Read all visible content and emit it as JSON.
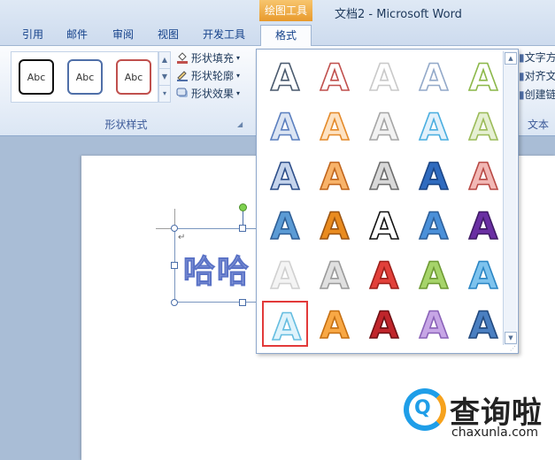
{
  "window": {
    "context_tab": "绘图工具",
    "doc_title": "文档2  -  Microsoft Word"
  },
  "tabs": [
    {
      "label": "引用"
    },
    {
      "label": "邮件"
    },
    {
      "label": "审阅"
    },
    {
      "label": "视图"
    },
    {
      "label": "开发工具"
    },
    {
      "label": "格式",
      "active": true
    }
  ],
  "ribbon": {
    "shape_styles": {
      "thumbs": [
        {
          "label": "Abc",
          "border_color": "#111111"
        },
        {
          "label": "Abc",
          "border_color": "#4f6fa8"
        },
        {
          "label": "Abc",
          "border_color": "#c0504d"
        }
      ],
      "commands": [
        {
          "label": "形状填充",
          "icon": "paint-bucket-icon"
        },
        {
          "label": "形状轮廓",
          "icon": "pencil-outline-icon"
        },
        {
          "label": "形状效果",
          "icon": "shape-effects-icon"
        }
      ],
      "group_label": "形状样式"
    },
    "text_group": {
      "commands": [
        {
          "label": "文字方向"
        },
        {
          "label": "对齐文本"
        },
        {
          "label": "创建链接"
        }
      ],
      "group_label": "文本"
    }
  },
  "document": {
    "wordart_text": "哈哈",
    "paragraph_mark": "↵"
  },
  "wordart_gallery": {
    "glyph": "A",
    "rows": [
      [
        {
          "fill": "#ffffff",
          "stroke": "#4a5a6e"
        },
        {
          "fill": "#ffffff",
          "stroke": "#c0504d"
        },
        {
          "fill": "#ffffff",
          "stroke": "#c9c9c9"
        },
        {
          "fill": "#ffffff",
          "stroke": "#93a9c9"
        },
        {
          "fill": "#ffffff",
          "stroke": "#8cb84a"
        }
      ],
      [
        {
          "fill": "#dce5f3",
          "stroke": "#5b7fbf"
        },
        {
          "fill": "#fde2c2",
          "stroke": "#e48a2a"
        },
        {
          "fill": "#f2f2f2",
          "stroke": "#a6a6a6"
        },
        {
          "fill": "#e2f1fb",
          "stroke": "#4aaee0"
        },
        {
          "fill": "#e6f0d3",
          "stroke": "#9bbb59"
        }
      ],
      [
        {
          "fill": "#c5d4ec",
          "stroke": "#2e4f8a"
        },
        {
          "fill": "#f8b36a",
          "stroke": "#c0651c"
        },
        {
          "fill": "#d9d9d9",
          "stroke": "#6d6d6d"
        },
        {
          "fill": "#2f6bbf",
          "stroke": "#1b4585"
        },
        {
          "fill": "#f2b8b5",
          "stroke": "#b84944"
        }
      ],
      [
        {
          "fill": "#5b9bd5",
          "stroke": "#2f5f96"
        },
        {
          "fill": "#e98b1f",
          "stroke": "#9c5512"
        },
        {
          "fill": "#ffffff",
          "stroke": "#111111"
        },
        {
          "fill": "#4a90d9",
          "stroke": "#2d5f99"
        },
        {
          "fill": "#6a2fa3",
          "stroke": "#3f1b66"
        }
      ],
      [
        {
          "fill": "#f4f4f4",
          "stroke": "#d0d0d0"
        },
        {
          "fill": "#e0e0e0",
          "stroke": "#9a9a9a"
        },
        {
          "fill": "#e2403a",
          "stroke": "#9c1f1a"
        },
        {
          "fill": "#a6d46a",
          "stroke": "#6e9a34"
        },
        {
          "fill": "#7ec3ee",
          "stroke": "#2b86c4"
        }
      ],
      [
        {
          "fill": "#dff3fb",
          "stroke": "#65bde0",
          "selected": true
        },
        {
          "fill": "#f8a845",
          "stroke": "#c56f12"
        },
        {
          "fill": "#c0252b",
          "stroke": "#6e1014"
        },
        {
          "fill": "#c7a6e6",
          "stroke": "#8a62b8"
        },
        {
          "fill": "#4a7fc1",
          "stroke": "#22497e"
        }
      ]
    ]
  },
  "watermark": {
    "brand_cn": "查询啦",
    "url": "chaxunla.com",
    "colors": {
      "blue": "#1f9ee8",
      "orange": "#f6a21d"
    }
  }
}
